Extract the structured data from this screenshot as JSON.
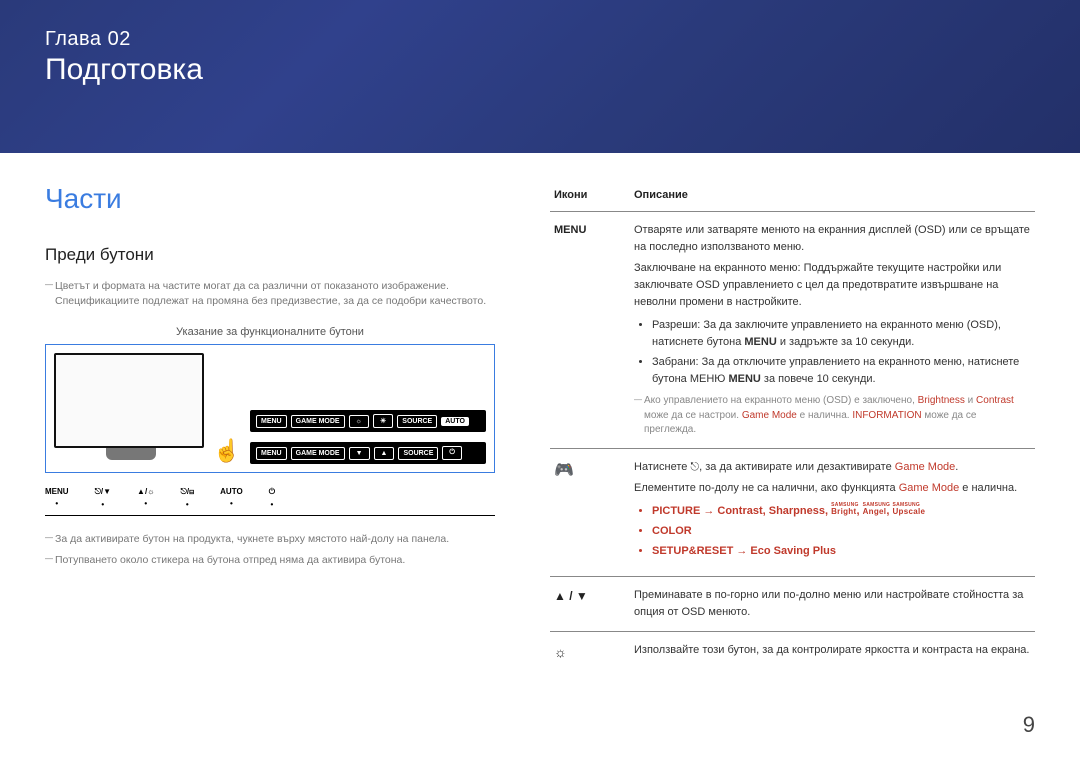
{
  "banner": {
    "chapter": "Глава 02",
    "title": "Подготовка"
  },
  "left": {
    "section_heading": "Части",
    "sub_heading": "Преди бутони",
    "note1": "Цветът и формата на частите могат да са различни от показаното изображение. Спецификациите подлежат на промяна без предизвестие, за да се подобри качеството.",
    "diagram_caption": "Указание за функционалните бутони",
    "row_labels": {
      "menu": "MENU",
      "game": "GAME MODE",
      "source": "SOURCE",
      "auto": "AUTO"
    },
    "panel": [
      "MENU",
      "⎋/▼",
      "▲/☼",
      "⎋/⊟",
      "AUTO",
      "⏻"
    ],
    "note2": "За да активирате бутон на продукта, чукнете върху мястото най-долу на панела.",
    "note3": "Потупването около стикера на бутона отпред няма да активира бутона."
  },
  "table": {
    "header_icons": "Икони",
    "header_desc": "Описание",
    "rows": [
      {
        "icon_type": "menu",
        "icon_label": "MENU",
        "desc": {
          "para1": "Отваряте или затваряте менюто на екранния дисплей (OSD) или се връщате на последно използваното меню.",
          "para2": "Заключване на екранното меню: Поддържайте текущите настройки или заключвате OSD управлението с цел да предотвратите извършване на неволни промени в настройките.",
          "bullets": [
            {
              "prefix": "Разреши: За да заключите управлението на екранното меню (OSD), натиснете бутона ",
              "bold": "MENU",
              "suffix": " и задръжте за 10 секунди."
            },
            {
              "prefix": "Забрани: За да отключите управлението на екранното меню, натиснете бутона МЕНЮ ",
              "bold": "MENU",
              "suffix": " за повече 10 секунди."
            }
          ],
          "subnote_pre": "Ако управлението на екранното меню (OSD) е заключено, ",
          "subnote_b1": "Brightness",
          "subnote_mid1": " и ",
          "subnote_b2": "Contrast",
          "subnote_mid2": " може да се настрои. ",
          "subnote_b3": "Game Mode",
          "subnote_mid3": " е налична. ",
          "subnote_b4": "INFORMATION",
          "subnote_end": " може да се преглежда."
        }
      },
      {
        "icon_type": "gamepad",
        "desc": {
          "line1_pre": "Натиснете ⎋, за да активирате или дезактивирате ",
          "line1_hl": "Game Mode",
          "line1_post": ".",
          "line2_pre": "Елементите по-долу не са налични, ако функцията ",
          "line2_hl": "Game Mode",
          "line2_post": " е налична.",
          "bullets": [
            {
              "text": "PICTURE → Contrast, Sharpness, ",
              "magic": [
                "Bright",
                "Angel",
                "Upscale"
              ]
            },
            {
              "text": "COLOR"
            },
            {
              "text": "SETUP&RESET → Eco Saving Plus"
            }
          ]
        }
      },
      {
        "icon_type": "arrows",
        "icon_label": "▲ / ▼",
        "desc_text": "Преминавате в по-горно или по-долно меню или настройвате стойността за опция от OSD менюто."
      },
      {
        "icon_type": "sun",
        "icon_label": "☼",
        "desc_text": "Използвайте този бутон, за да контролирате яркостта и контраста на екрана."
      }
    ]
  },
  "page_number": "9"
}
